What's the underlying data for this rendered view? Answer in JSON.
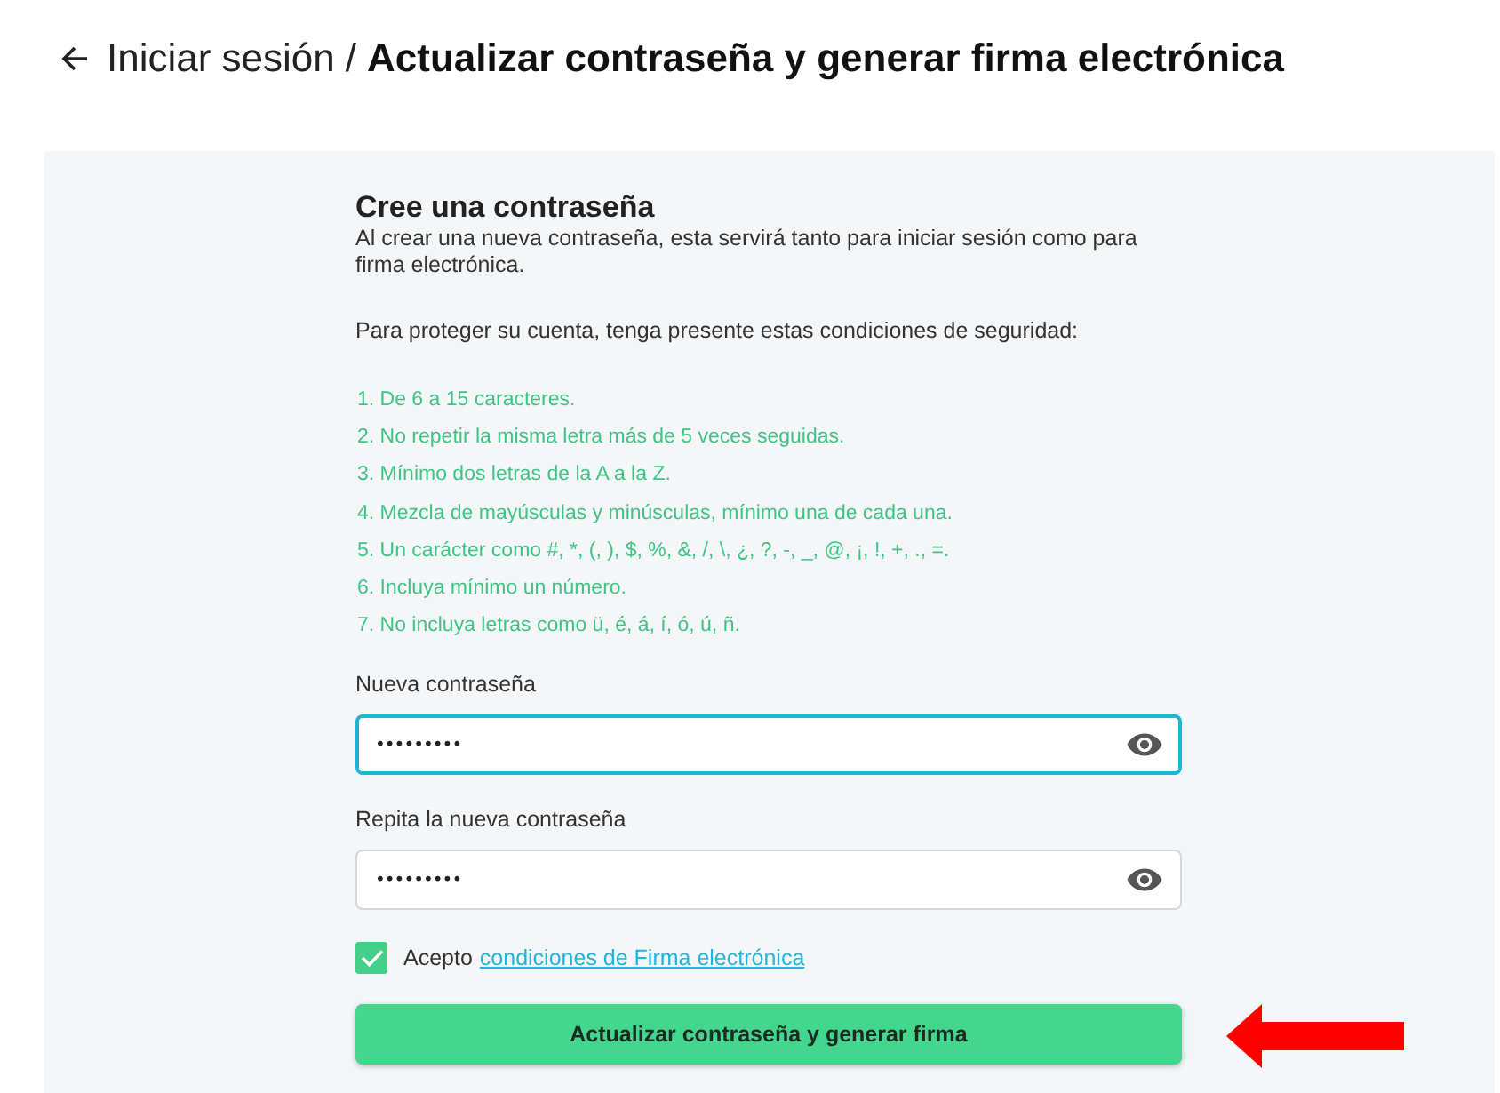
{
  "header": {
    "breadcrumb": "Iniciar sesión",
    "separator": "/",
    "title": "Actualizar contraseña y generar firma electrónica"
  },
  "form": {
    "title": "Cree una contraseña",
    "intro": "Al crear una nueva contraseña, esta servirá tanto para iniciar sesión como para firma electrónica.",
    "conditions_intro": "Para proteger su cuenta, tenga presente estas condiciones de seguridad:",
    "rules": [
      "1. De 6 a 15 caracteres.",
      "2. No repetir la misma letra más de 5 veces seguidas.",
      "3. Mínimo dos letras de la A a la Z.",
      "4. Mezcla de mayúsculas y minúsculas, mínimo una de cada una.",
      "5. Un carácter como #, *, (, ), $, %, &, /, \\, ¿, ?, -, _, @, ¡, !, +, ., =.",
      "6. Incluya mínimo un número.",
      "7. No incluya letras como ü, é, á, í, ó, ú, ñ."
    ],
    "fields": [
      {
        "label": "Nueva contraseña",
        "value": "•••••••••",
        "focused": true
      },
      {
        "label": "Repita la nueva contraseña",
        "value": "•••••••••",
        "focused": false
      }
    ],
    "terms": {
      "checked": true,
      "text": "Acepto",
      "link": "condiciones de Firma electrónica"
    },
    "submit": "Actualizar contraseña y generar firma"
  }
}
